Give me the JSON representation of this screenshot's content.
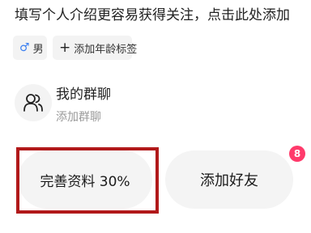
{
  "profile": {
    "intro_prompt": "填写个人介绍更容易获得关注，点击此处添加",
    "tags": {
      "gender_icon": "male-icon",
      "gender_label": "男",
      "add_icon": "plus-icon",
      "add_age_label": "添加年龄标签"
    }
  },
  "group_chat": {
    "icon": "group-icon",
    "title": "我的群聊",
    "subtitle": "添加群聊"
  },
  "actions": {
    "complete_profile_label": "完善资料 30%",
    "add_friend_label": "添加好友",
    "add_friend_badge": "8"
  },
  "colors": {
    "highlight_border": "#b1191a",
    "badge": "#ff3a6b",
    "male_icon": "#3b7ff0"
  }
}
